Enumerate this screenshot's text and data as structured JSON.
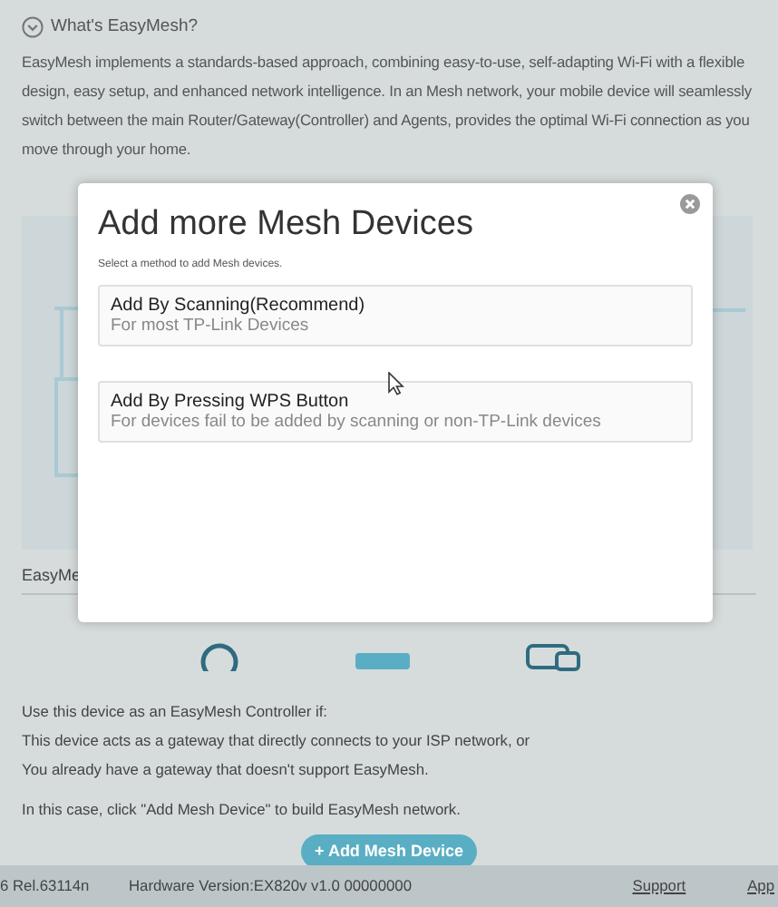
{
  "info": {
    "heading": "What's EasyMesh?",
    "text": "EasyMesh implements a standards-based approach, combining easy-to-use, self-adapting Wi-Fi with a flexible design, easy setup, and enhanced network intelligence. In an Mesh network, your mobile device will seamlessly switch between the main Router/Gateway(Controller) and Agents, provides the optimal Wi-Fi connection as you move through your home."
  },
  "section_label": "EasyMe",
  "controller_info": [
    "Use this device as an EasyMesh Controller if:",
    "This device acts as a gateway that directly connects to your ISP network, or",
    "You already have a gateway that doesn't support EasyMesh.",
    "In this case, click \"Add Mesh Device\" to build EasyMesh network."
  ],
  "add_button": "+ Add Mesh Device",
  "footer": {
    "firmware": "6 Rel.63114n",
    "hardware": "Hardware Version:EX820v v1.0 00000000",
    "links": [
      "Support",
      "App"
    ]
  },
  "dialog": {
    "title": "Add more Mesh Devices",
    "subtitle": "Select a method to add Mesh devices.",
    "options": [
      {
        "title": "Add By Scanning(Recommend)",
        "description": "For most TP-Link Devices"
      },
      {
        "title": "Add By Pressing WPS Button",
        "description": "For devices fail to be added by scanning or non-TP-Link devices"
      }
    ]
  }
}
